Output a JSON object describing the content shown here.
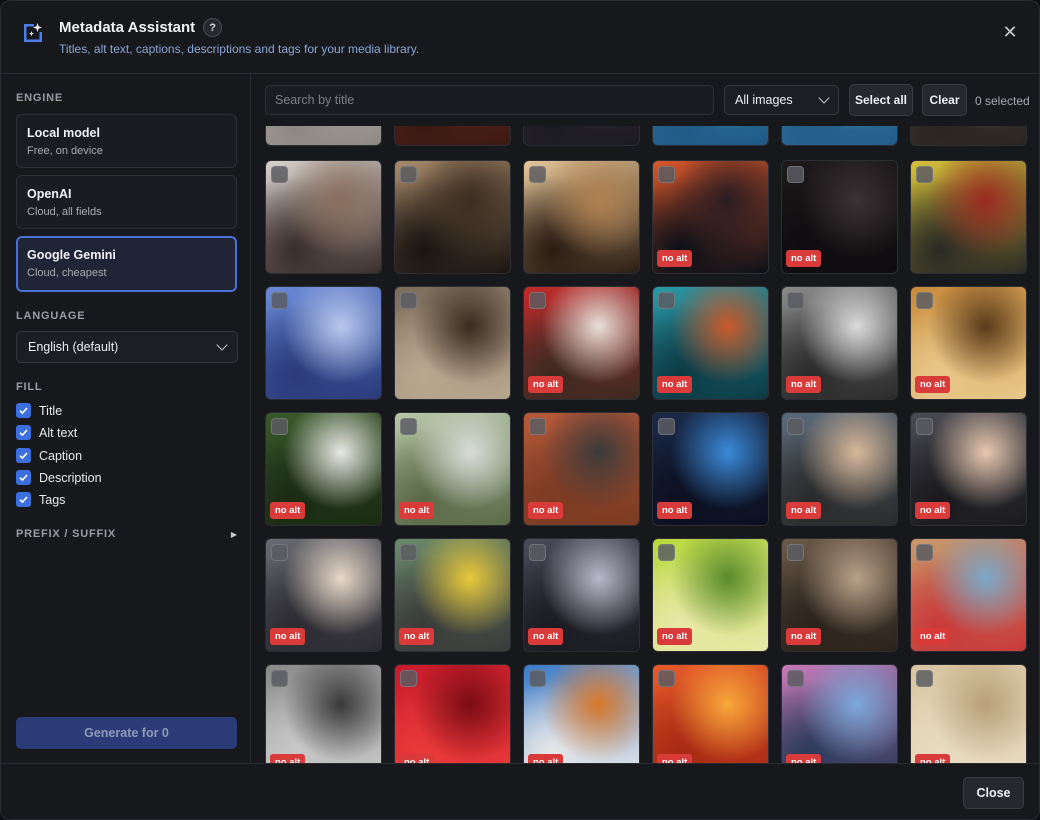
{
  "header": {
    "title": "Metadata Assistant",
    "help_label": "?",
    "subtitle": "Titles, alt text, captions, descriptions and tags for your media library.",
    "close_glyph": "✕"
  },
  "sidebar": {
    "engine_label": "ENGINE",
    "engines": [
      {
        "name": "Local model",
        "desc": "Free, on device",
        "selected": false
      },
      {
        "name": "OpenAI",
        "desc": "Cloud, all fields",
        "selected": false
      },
      {
        "name": "Google Gemini",
        "desc": "Cloud, cheapest",
        "selected": true
      }
    ],
    "language_label": "LANGUAGE",
    "language_value": "English (default)",
    "fill_label": "FILL",
    "fill_items": [
      {
        "label": "Title",
        "checked": true
      },
      {
        "label": "Alt text",
        "checked": true
      },
      {
        "label": "Caption",
        "checked": true
      },
      {
        "label": "Description",
        "checked": true
      },
      {
        "label": "Tags",
        "checked": true
      }
    ],
    "prefix_label": "PREFIX / SUFFIX",
    "prefix_arrow": "▶",
    "generate_label": "Generate for 0"
  },
  "toolbar": {
    "search_placeholder": "Search by title",
    "filter_value": "All images",
    "select_all_label": "Select all",
    "clear_label": "Clear",
    "selected_count": "0 selected"
  },
  "grid": {
    "badge_label": "no alt",
    "tiles": [
      {
        "icon": "paper-scraps-image",
        "badge": false,
        "c1": "#e9e6e2",
        "c2": "#bfb8b0",
        "c3": "#8c8680"
      },
      {
        "icon": "market-crowd-image",
        "badge": false,
        "c1": "#8a2a1f",
        "c2": "#c4452f",
        "c3": "#3a1a14"
      },
      {
        "icon": "city-dusk-image",
        "badge": false,
        "c1": "#3b3340",
        "c2": "#8a6a62",
        "c3": "#1c1a22"
      },
      {
        "icon": "blue-fabric-image",
        "badge": false,
        "c1": "#3a8fc9",
        "c2": "#a5d4ee",
        "c3": "#1f5a86"
      },
      {
        "icon": "blue-fabric-image",
        "badge": false,
        "c1": "#3f96d0",
        "c2": "#b3dcf2",
        "c3": "#225c8a"
      },
      {
        "icon": "street-image",
        "badge": false,
        "c1": "#5a5048",
        "c2": "#a09080",
        "c3": "#2a2420"
      },
      {
        "icon": "textile-market-image",
        "badge": false,
        "c1": "#d8d2cc",
        "c2": "#8a6e5e",
        "c3": "#3a2e2a"
      },
      {
        "icon": "rodeo-bull-image",
        "badge": false,
        "c1": "#a88a6a",
        "c2": "#3a2c20",
        "c3": "#1a1410"
      },
      {
        "icon": "rodeo-horse-image",
        "badge": false,
        "c1": "#e6c79a",
        "c2": "#b08050",
        "c3": "#2a1c12"
      },
      {
        "icon": "ferris-wheel-image",
        "badge": true,
        "c1": "#d8562a",
        "c2": "#2a1c22",
        "c3": "#0c1018"
      },
      {
        "icon": "night-sky-image",
        "badge": true,
        "c1": "#1e1a1c",
        "c2": "#3a3234",
        "c3": "#0e0c0e"
      },
      {
        "icon": "subway-train-image",
        "badge": false,
        "c1": "#d8c23a",
        "c2": "#9a2a22",
        "c3": "#2a2a24"
      },
      {
        "icon": "blue-flowers-image",
        "badge": false,
        "c1": "#6a8ad8",
        "c2": "#b8c8ee",
        "c3": "#2a3a7a"
      },
      {
        "icon": "elder-portrait-image",
        "badge": false,
        "c1": "#7a6a58",
        "c2": "#3a2a20",
        "c3": "#b8a890"
      },
      {
        "icon": "red-coat-portrait-image",
        "badge": true,
        "c1": "#c42a2a",
        "c2": "#e8e0d8",
        "c3": "#3a2a22"
      },
      {
        "icon": "lionfish-image",
        "badge": true,
        "c1": "#2a9aa8",
        "c2": "#c85a2a",
        "c3": "#0c3a44"
      },
      {
        "icon": "holding-hands-bw-image",
        "badge": true,
        "c1": "#8a8a8a",
        "c2": "#dadada",
        "c3": "#2a2a2a"
      },
      {
        "icon": "dancing-couple-image",
        "badge": true,
        "c1": "#c88a3a",
        "c2": "#5a3a1a",
        "c3": "#e8c88a"
      },
      {
        "icon": "white-rabbit-image",
        "badge": true,
        "c1": "#3a5a2a",
        "c2": "#e8e8e4",
        "c3": "#1a2a14"
      },
      {
        "icon": "girl-on-road-image",
        "badge": true,
        "c1": "#b8c8a8",
        "c2": "#d8dcd8",
        "c3": "#5a6a48"
      },
      {
        "icon": "selfie-brick-wall-image",
        "badge": true,
        "c1": "#b85a3a",
        "c2": "#3a3a3a",
        "c3": "#7a3a22"
      },
      {
        "icon": "studio-monitors-image",
        "badge": true,
        "c1": "#1a2a4a",
        "c2": "#3a8ad8",
        "c3": "#0c1020"
      },
      {
        "icon": "group-selfie-image",
        "badge": true,
        "c1": "#5a6a7a",
        "c2": "#d8b89a",
        "c3": "#2a2a2a"
      },
      {
        "icon": "friends-selfie-image",
        "badge": true,
        "c1": "#4a4a52",
        "c2": "#e8c8b0",
        "c3": "#1a1a1e"
      },
      {
        "icon": "woman-laptop-image",
        "badge": true,
        "c1": "#6a6a72",
        "c2": "#e8d8c8",
        "c3": "#2a2a30"
      },
      {
        "icon": "friends-laughing-image",
        "badge": true,
        "c1": "#6a8a6a",
        "c2": "#e8c83a",
        "c3": "#3a3a3a"
      },
      {
        "icon": "skateboarders-image",
        "badge": true,
        "c1": "#4a4a5a",
        "c2": "#b8b8c8",
        "c3": "#1a1a22"
      },
      {
        "icon": "holding-hands-bokeh-image",
        "badge": true,
        "c1": "#b8d83a",
        "c2": "#5a8a2a",
        "c3": "#e8e8a8"
      },
      {
        "icon": "old-building-image",
        "badge": true,
        "c1": "#6a5a48",
        "c2": "#b8a088",
        "c3": "#2a221c"
      },
      {
        "icon": "red-dress-arch-image",
        "badge": true,
        "c1": "#c89a6a",
        "c2": "#7aa8c8",
        "c3": "#c83a3a"
      },
      {
        "icon": "crowd-bw-image",
        "badge": true,
        "c1": "#8a8a8a",
        "c2": "#3a3a3a",
        "c3": "#c8c8c8"
      },
      {
        "icon": "red-petals-image",
        "badge": true,
        "c1": "#c81a2a",
        "c2": "#7a0c14",
        "c3": "#e83a3a"
      },
      {
        "icon": "red-fox-image",
        "badge": true,
        "c1": "#3a7ac8",
        "c2": "#d8782a",
        "c3": "#e8e8e8"
      },
      {
        "icon": "orange-flower-image",
        "badge": true,
        "c1": "#e85a2a",
        "c2": "#f8a83a",
        "c3": "#a82a14"
      },
      {
        "icon": "pier-sunset-image",
        "badge": true,
        "c1": "#c87ab8",
        "c2": "#7aa8d8",
        "c3": "#2a3a5a"
      },
      {
        "icon": "sand-lizard-image",
        "badge": true,
        "c1": "#d8c4a0",
        "c2": "#b8a07a",
        "c3": "#e8dcc0"
      }
    ]
  },
  "footer": {
    "close_label": "Close"
  }
}
